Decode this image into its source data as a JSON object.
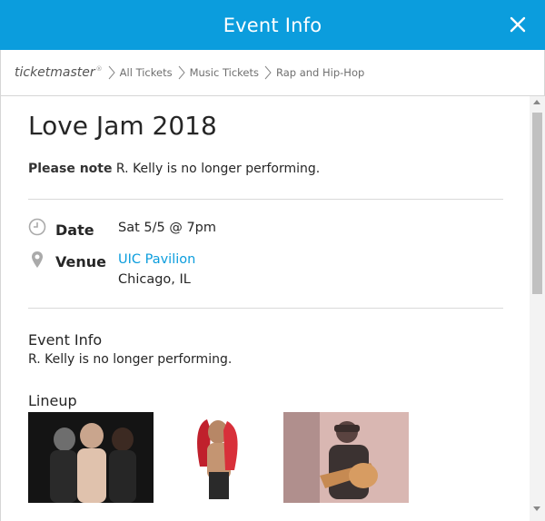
{
  "header": {
    "title": "Event Info"
  },
  "breadcrumb": {
    "logo": "ticketmaster",
    "items": [
      "All Tickets",
      "Music Tickets",
      "Rap and Hip-Hop"
    ]
  },
  "event": {
    "title": "Love Jam 2018",
    "note_label": "Please note",
    "note_text": " R. Kelly is no longer performing.",
    "date_label": "Date",
    "date_value": "Sat 5/5 @ 7pm",
    "venue_label": "Venue",
    "venue_name": "UIC Pavilion",
    "venue_city": "Chicago, IL"
  },
  "event_info": {
    "heading": "Event Info",
    "text": "R. Kelly is no longer performing."
  },
  "lineup": {
    "heading": "Lineup"
  },
  "colors": {
    "accent": "#0b9ddd",
    "header_bg": "#0b9ddd"
  }
}
